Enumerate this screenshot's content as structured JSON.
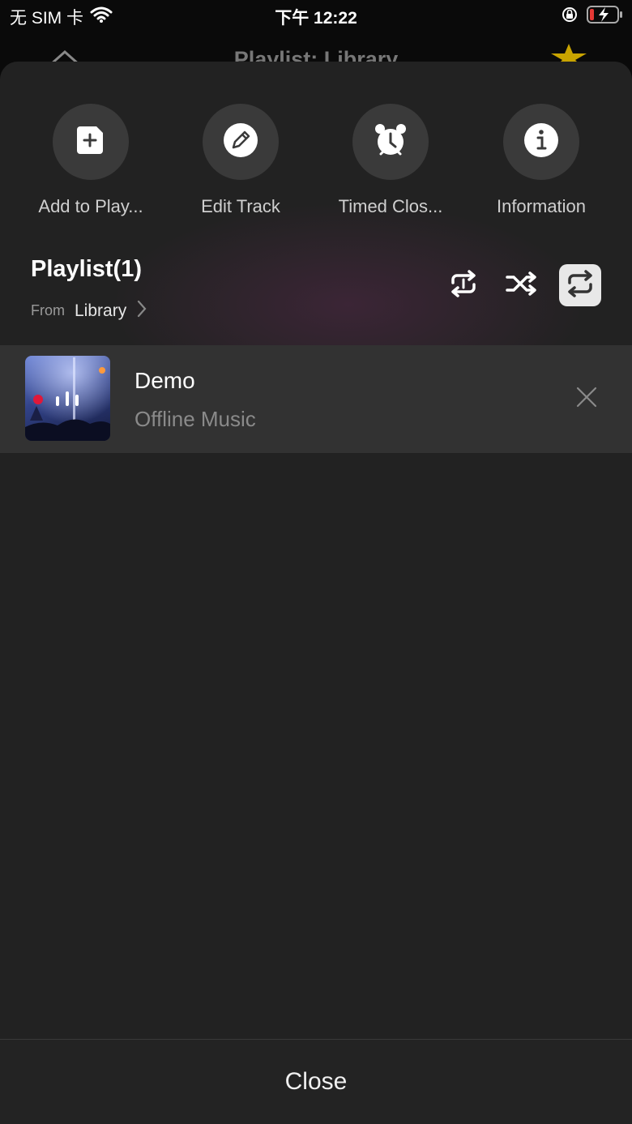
{
  "status_bar": {
    "carrier": "无 SIM 卡",
    "time": "下午 12:22",
    "icons": [
      "wifi-icon",
      "orientation-lock-icon",
      "battery-charging-icon"
    ]
  },
  "behind": {
    "title": "Playlist: Library",
    "icons": [
      "close-icon",
      "star-icon"
    ]
  },
  "actions": [
    {
      "label": "Add to Play...",
      "icon": "add-to-playlist-icon"
    },
    {
      "label": "Edit Track",
      "icon": "pencil-icon"
    },
    {
      "label": "Timed Clos...",
      "icon": "alarm-clock-icon"
    },
    {
      "label": "Information",
      "icon": "info-icon"
    }
  ],
  "playlist": {
    "title": "Playlist(1)",
    "from_label": "From",
    "from_value": "Library",
    "modes": [
      "repeat-all-icon",
      "shuffle-icon",
      "repeat-icon"
    ],
    "active_mode": "repeat-icon"
  },
  "tracks": [
    {
      "title": "Demo",
      "subtitle": "Offline Music",
      "playing": true
    }
  ],
  "close_label": "Close",
  "colors": {
    "sheet": "#222222",
    "track_row": "#323232",
    "star": "#c9a400"
  }
}
